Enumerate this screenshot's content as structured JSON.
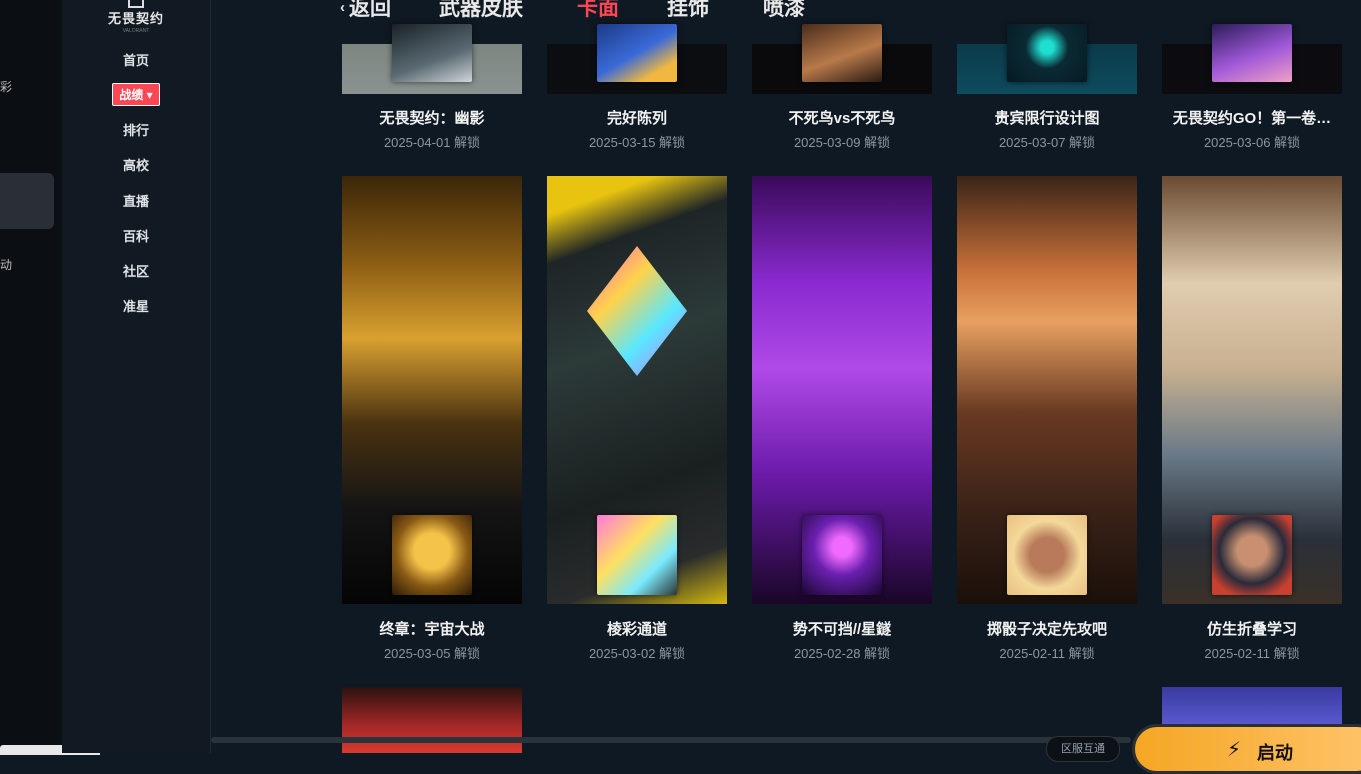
{
  "app": {
    "logo_text": "无畏契约",
    "logo_sub": "VALORANT"
  },
  "left_strip": {
    "text_top": "彩",
    "text_bottom": "动"
  },
  "nav": {
    "items": [
      {
        "label": "首页"
      },
      {
        "label": "战绩",
        "active": true,
        "chevron": "▾"
      },
      {
        "label": "排行"
      },
      {
        "label": "高校"
      },
      {
        "label": "直播"
      },
      {
        "label": "百科"
      },
      {
        "label": "社区"
      },
      {
        "label": "准星"
      }
    ]
  },
  "tabs": {
    "back_chevron": "‹",
    "back": "返回",
    "items": [
      {
        "label": "武器皮肤"
      },
      {
        "label": "卡面",
        "active": true
      },
      {
        "label": "挂饰"
      },
      {
        "label": "喷漆"
      }
    ]
  },
  "cards": [
    {
      "name": "无畏契约：幽影",
      "date": "2025-04-01 解锁"
    },
    {
      "name": "完好陈列",
      "date": "2025-03-15 解锁"
    },
    {
      "name": "不死鸟vs不死鸟",
      "date": "2025-03-09 解锁"
    },
    {
      "name": "贵宾限行设计图",
      "date": "2025-03-07 解锁"
    },
    {
      "name": "无畏契约GO！第一卷…",
      "date": "2025-03-06 解锁"
    },
    {
      "name": "终章：宇宙大战",
      "date": "2025-03-05 解锁"
    },
    {
      "name": "棱彩通道",
      "date": "2025-03-02 解锁"
    },
    {
      "name": "势不可挡//星鐩",
      "date": "2025-02-28 解锁"
    },
    {
      "name": "掷骰子决定先攻吧",
      "date": "2025-02-11 解锁"
    },
    {
      "name": "仿生折叠学习",
      "date": "2025-02-11 解锁"
    }
  ],
  "bottom": {
    "region": "区服互通",
    "launch": "启动",
    "launch_icon": "lightning-icon"
  },
  "colors": {
    "accent": "#ff4655",
    "bg": "#0f1923",
    "launch": "#f5a623"
  }
}
